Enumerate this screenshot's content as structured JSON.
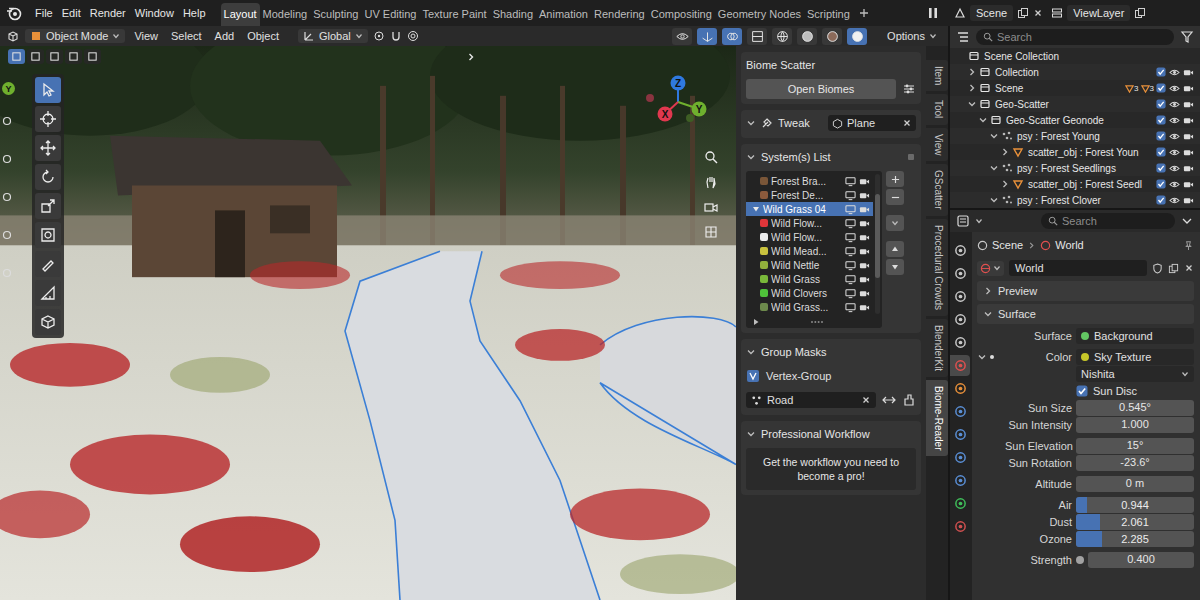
{
  "menu": [
    "File",
    "Edit",
    "Render",
    "Window",
    "Help"
  ],
  "workspaces": [
    {
      "label": "Layout",
      "selected": true
    },
    {
      "label": "Modeling",
      "selected": false
    },
    {
      "label": "Sculpting",
      "selected": false
    },
    {
      "label": "UV Editing",
      "selected": false
    },
    {
      "label": "Texture Paint",
      "selected": false
    },
    {
      "label": "Shading",
      "selected": false
    },
    {
      "label": "Animation",
      "selected": false
    },
    {
      "label": "Rendering",
      "selected": false
    },
    {
      "label": "Compositing",
      "selected": false
    },
    {
      "label": "Geometry Nodes",
      "selected": false
    },
    {
      "label": "Scripting",
      "selected": false
    }
  ],
  "top_right": {
    "scene": "Scene",
    "view_layer": "ViewLayer"
  },
  "viewport": {
    "mode": "Object Mode",
    "menus": [
      "View",
      "Select",
      "Add",
      "Object"
    ],
    "orientation": "Global",
    "options": "Options",
    "display_buttons": [
      {
        "kind": "visibility",
        "selected": false
      },
      {
        "kind": "gizmo",
        "selected": true
      },
      {
        "kind": "overlays",
        "selected": true
      },
      {
        "kind": "xray",
        "selected": false
      },
      {
        "kind": "wireframe",
        "selected": false
      },
      {
        "kind": "solid",
        "selected": false
      },
      {
        "kind": "material",
        "selected": false
      },
      {
        "kind": "rendered",
        "selected": true
      }
    ],
    "tools": [
      {
        "kind": "select",
        "selected": true
      },
      {
        "kind": "cursor",
        "selected": false
      },
      {
        "kind": "move",
        "selected": false
      },
      {
        "kind": "rotate",
        "selected": false
      },
      {
        "kind": "scale",
        "selected": false
      },
      {
        "kind": "transform",
        "selected": false
      },
      {
        "kind": "annotate",
        "selected": false
      },
      {
        "kind": "measure",
        "selected": false
      },
      {
        "kind": "add-cube",
        "selected": false
      }
    ],
    "gizmo": [
      {
        "label": "Z",
        "color": "#2f79e0"
      },
      {
        "label": "Y",
        "color": "#6fb02e"
      },
      {
        "label": "X",
        "color": "#e0384f"
      }
    ],
    "edge_badge": "Y"
  },
  "n_panel": {
    "tabs": [
      {
        "label": "Item",
        "selected": false
      },
      {
        "label": "Tool",
        "selected": false
      },
      {
        "label": "View",
        "selected": false
      },
      {
        "label": "GScatter",
        "selected": false
      },
      {
        "label": "Procedural Crowds",
        "selected": false
      },
      {
        "label": "BlenderKit",
        "selected": false
      },
      {
        "label": "Biome-Reader",
        "selected": true
      }
    ],
    "biome": {
      "title": "Biome Scatter",
      "button": "Open Biomes"
    },
    "tweak": {
      "title": "Tweak",
      "expanded": true,
      "target": "Plane"
    },
    "systems": {
      "title": "System(s) List",
      "expanded": true,
      "items": [
        {
          "name": "Forest Bra...",
          "kind": "system",
          "depth": 1,
          "color": "#7a5638",
          "selected": false
        },
        {
          "name": "Forest De...",
          "kind": "system",
          "depth": 1,
          "color": "#8c5a3c",
          "selected": false
        },
        {
          "name": "Wild Grass 04",
          "kind": "group",
          "depth": 0,
          "selected": true
        },
        {
          "name": "Wild Flow...",
          "kind": "system",
          "depth": 1,
          "color": "#e0363a",
          "selected": false
        },
        {
          "name": "Wild Flow...",
          "kind": "system",
          "depth": 1,
          "color": "#ececec",
          "selected": false
        },
        {
          "name": "Wild Mead...",
          "kind": "system",
          "depth": 1,
          "color": "#c9c23e",
          "selected": false
        },
        {
          "name": "Wild Nettle",
          "kind": "system",
          "depth": 1,
          "color": "#93b03c",
          "selected": false
        },
        {
          "name": "Wild Grass",
          "kind": "system",
          "depth": 1,
          "color": "#79b83a",
          "selected": false
        },
        {
          "name": "Wild Clovers",
          "kind": "system",
          "depth": 1,
          "color": "#4fc23a",
          "selected": false
        },
        {
          "name": "Wild Grass...",
          "kind": "system",
          "depth": 1,
          "color": "#6d8a4c",
          "selected": false
        }
      ]
    },
    "masks": {
      "title": "Group Masks",
      "expanded": true,
      "method": "Vertex-Group",
      "group": "Road"
    },
    "workflow": {
      "title": "Professional Workflow",
      "expanded": true,
      "text": "Get the workflow you need to become a pro!"
    }
  },
  "outliner": {
    "search": "Search",
    "rows": [
      {
        "name": "Scene Collection",
        "depth": 0,
        "kind": "root",
        "expandable": false,
        "expanded": false
      },
      {
        "name": "Collection",
        "depth": 1,
        "kind": "collection",
        "expandable": true,
        "expanded": false,
        "checked": true
      },
      {
        "name": "Scene",
        "depth": 1,
        "kind": "collection",
        "expandable": true,
        "expanded": false,
        "checked": true,
        "badges": [
          "3",
          "3"
        ]
      },
      {
        "name": "Geo-Scatter",
        "depth": 1,
        "kind": "collection",
        "expandable": true,
        "expanded": true,
        "checked": true
      },
      {
        "name": "Geo-Scatter Geonode",
        "depth": 2,
        "kind": "collection",
        "expandable": true,
        "expanded": true,
        "checked": true
      },
      {
        "name": "psy : Forest Young",
        "depth": 3,
        "kind": "particles",
        "expandable": true,
        "expanded": true,
        "checked": true
      },
      {
        "name": "scatter_obj : Forest Youn",
        "depth": 4,
        "kind": "object",
        "expandable": true,
        "expanded": false,
        "checked": true
      },
      {
        "name": "psy : Forest Seedlings",
        "depth": 3,
        "kind": "particles",
        "expandable": true,
        "expanded": true,
        "checked": true
      },
      {
        "name": "scatter_obj : Forest Seedl",
        "depth": 4,
        "kind": "object",
        "expandable": true,
        "expanded": false,
        "checked": true
      },
      {
        "name": "psy : Forest Clover",
        "depth": 3,
        "kind": "particles",
        "expandable": true,
        "expanded": true,
        "checked": true
      }
    ]
  },
  "properties": {
    "search": "Search",
    "breadcrumb": [
      "Scene",
      "World"
    ],
    "datablock": "World",
    "tabs": [
      {
        "color": "#c8c8c8",
        "selected": false
      },
      {
        "color": "#c8c8c8",
        "selected": false
      },
      {
        "color": "#c8c8c8",
        "selected": false
      },
      {
        "color": "#c8c8c8",
        "selected": false
      },
      {
        "color": "#c8c8c8",
        "selected": false
      },
      {
        "color": "#e0504f",
        "selected": true
      },
      {
        "color": "#e8903a",
        "selected": false
      },
      {
        "color": "#5a8fd6",
        "selected": false
      },
      {
        "color": "#5a8fd6",
        "selected": false
      },
      {
        "color": "#5a8fd6",
        "selected": false
      },
      {
        "color": "#5a8fd6",
        "selected": false
      },
      {
        "color": "#3fbf5a",
        "selected": false
      },
      {
        "color": "#d05050",
        "selected": false
      }
    ],
    "sections": [
      {
        "title": "Preview",
        "expanded": false
      },
      {
        "title": "Surface",
        "expanded": true,
        "rows": [
          {
            "kind": "link",
            "label": "Surface",
            "value": "Background",
            "color": "#63c763",
            "group": 0
          },
          {
            "kind": "link",
            "label": "Color",
            "value": "Sky Texture",
            "color": "#c7c729",
            "expanded": true,
            "group": 1
          },
          {
            "kind": "select",
            "value": "Nishita",
            "group": 1
          },
          {
            "kind": "checkbox",
            "value": "Sun Disc",
            "checked": true,
            "group": 1
          },
          {
            "kind": "number",
            "label": "Sun Size",
            "value": "0.545°",
            "group": 1
          },
          {
            "kind": "number",
            "label": "Sun Intensity",
            "value": "1.000",
            "group": 1
          },
          {
            "kind": "number",
            "label": "Sun Elevation",
            "value": "15°",
            "group": 2
          },
          {
            "kind": "number",
            "label": "Sun Rotation",
            "value": "-23.6°",
            "group": 2
          },
          {
            "kind": "number",
            "label": "Altitude",
            "value": "0 m",
            "group": 3
          },
          {
            "kind": "slider",
            "label": "Air",
            "value": "0.944",
            "level": 0.09,
            "group": 4
          },
          {
            "kind": "slider",
            "label": "Dust",
            "value": "2.061",
            "level": 0.2,
            "group": 4
          },
          {
            "kind": "slider",
            "label": "Ozone",
            "value": "2.285",
            "level": 0.22,
            "group": 4
          },
          {
            "kind": "number",
            "label": "Strength",
            "value": "0.400",
            "color": "#a1a1a1",
            "group": 5
          }
        ]
      }
    ]
  }
}
